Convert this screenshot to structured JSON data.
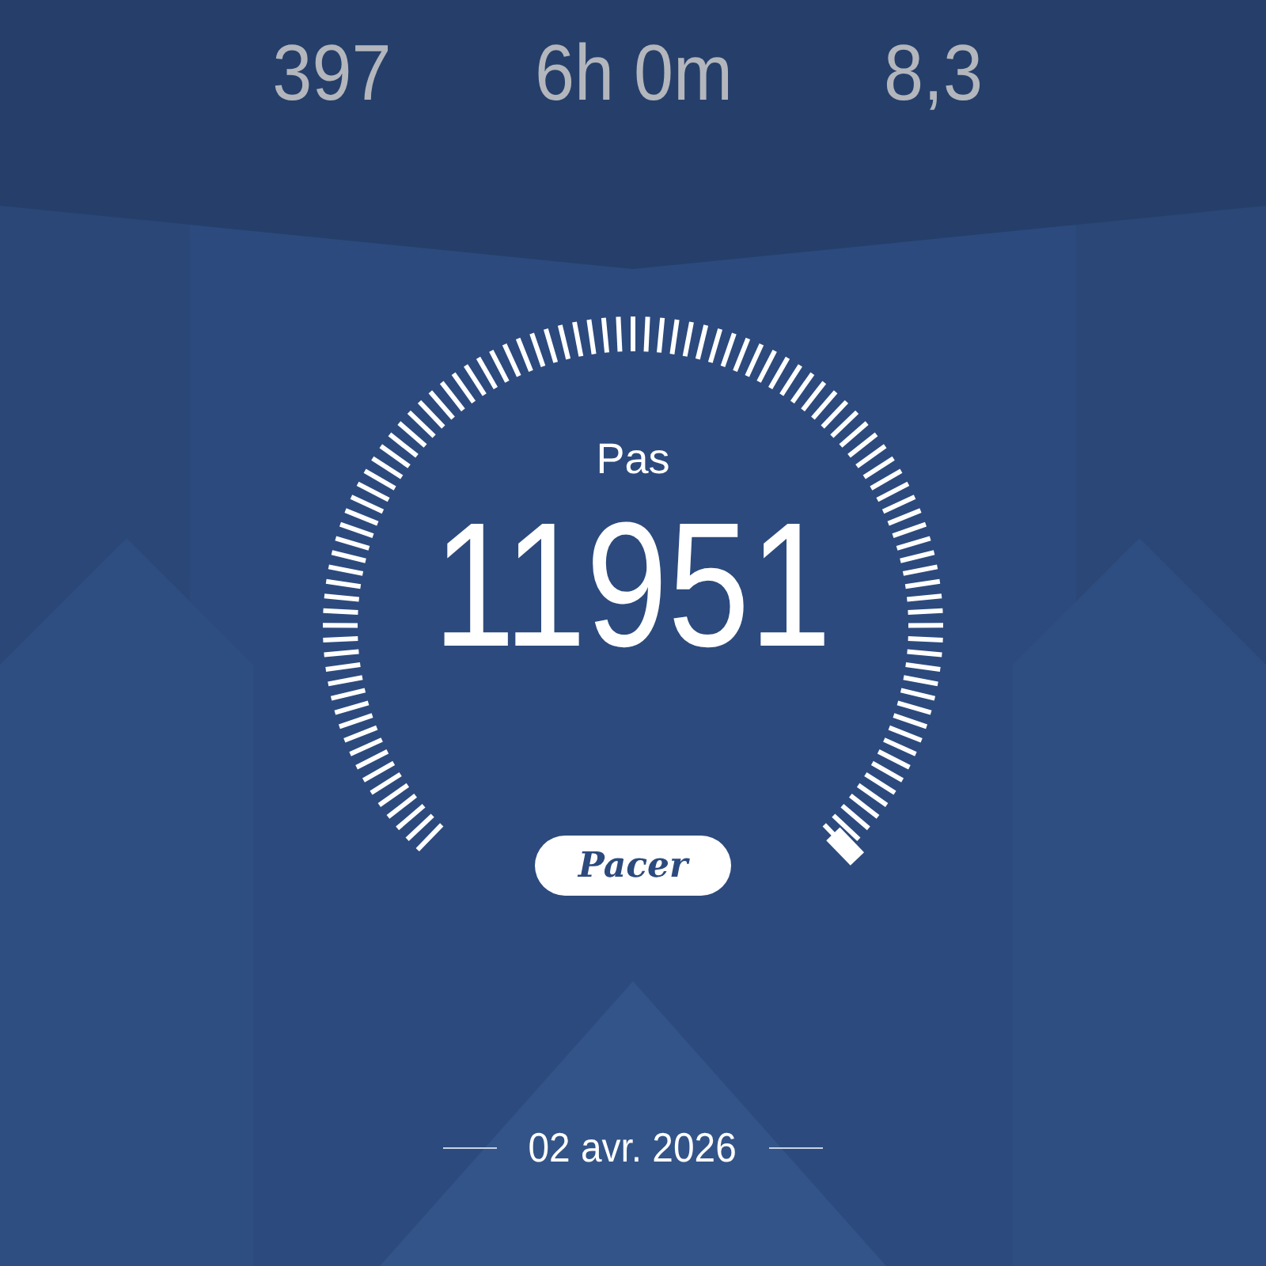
{
  "stats": [
    {
      "value": "397"
    },
    {
      "value": "6h 0m"
    },
    {
      "value": "8,3"
    }
  ],
  "gauge": {
    "label": "Pas",
    "value": "11951"
  },
  "badge": {
    "text": "Pacer"
  },
  "date": "02 avr. 2026"
}
